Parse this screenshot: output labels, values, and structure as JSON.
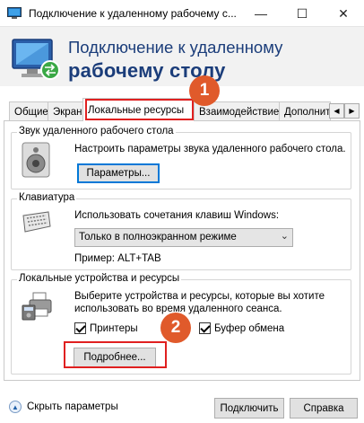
{
  "window": {
    "title": "Подключение к удаленному рабочему с...",
    "minimize_glyph": "—",
    "maximize_glyph": "☐",
    "close_glyph": "✕"
  },
  "header": {
    "line1": "Подключение к удаленному",
    "line2": "рабочему столу"
  },
  "tabs": [
    {
      "label": "Общие"
    },
    {
      "label": "Экран"
    },
    {
      "label": "Локальные ресурсы",
      "active": true
    },
    {
      "label": "Взаимодействие"
    },
    {
      "label": "Дополнит"
    }
  ],
  "tab_scroll": {
    "left": "◀",
    "right": "▶"
  },
  "sound": {
    "title": "Звук удаленного рабочего стола",
    "description": "Настроить параметры звука удаленного рабочего стола.",
    "button": "Параметры..."
  },
  "keyboard": {
    "title": "Клавиатура",
    "description": "Использовать сочетания клавиш Windows:",
    "select_value": "Только в полноэкранном режиме",
    "example": "Пример: ALT+TAB"
  },
  "devices": {
    "title": "Локальные устройства и ресурсы",
    "description_line1": "Выберите устройства и ресурсы, которые вы хотите",
    "description_line2": "использовать во время удаленного сеанса.",
    "printers": {
      "label": "Принтеры",
      "checked": true
    },
    "clipboard": {
      "label": "Буфер обмена",
      "checked": true
    },
    "more_button": "Подробнее..."
  },
  "annotations": {
    "badge1": "1",
    "badge2": "2",
    "color": "#e05a2b",
    "box_color": "#e02020"
  },
  "footer": {
    "hide_options": "Скрыть параметры",
    "connect": "Подключить",
    "help": "Справка"
  },
  "colors": {
    "header_text": "#1b3d7a",
    "header_bg": "#f2f2f2"
  }
}
